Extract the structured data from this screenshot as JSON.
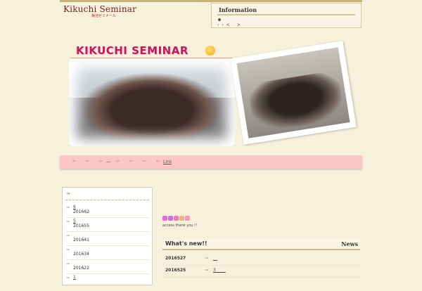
{
  "header": {
    "title": "Kikuchi Seminar",
    "subtitle": "菊池ゼミナール"
  },
  "info": {
    "title": "Information",
    "nav": "‹‹< >"
  },
  "banner": {
    "logo_text": "KIKUCHI SEMINAR"
  },
  "navbar": {
    "link_label": "Link",
    "current_marker": "—"
  },
  "sidebar": {
    "items": [
      {
        "count": "6",
        "date": "201662"
      },
      {
        "count": "5",
        "date": "201655"
      },
      {
        "count": "",
        "date": "201641"
      },
      {
        "count": "",
        "date": "201634"
      },
      {
        "count": "",
        "date": "201622"
      },
      {
        "count": "1",
        "date": ""
      }
    ]
  },
  "content": {
    "access_text": "access thank you !!",
    "whats_new_title": "What's new!!",
    "news_label": "News",
    "hearts": [
      "#e56bd9",
      "#c76fe6",
      "#f07ac2",
      "#f2b27a",
      "#f59ac0"
    ],
    "news": [
      {
        "date": "2016527",
        "text": "__"
      },
      {
        "date": "2016525",
        "text": "3 ____"
      }
    ]
  }
}
